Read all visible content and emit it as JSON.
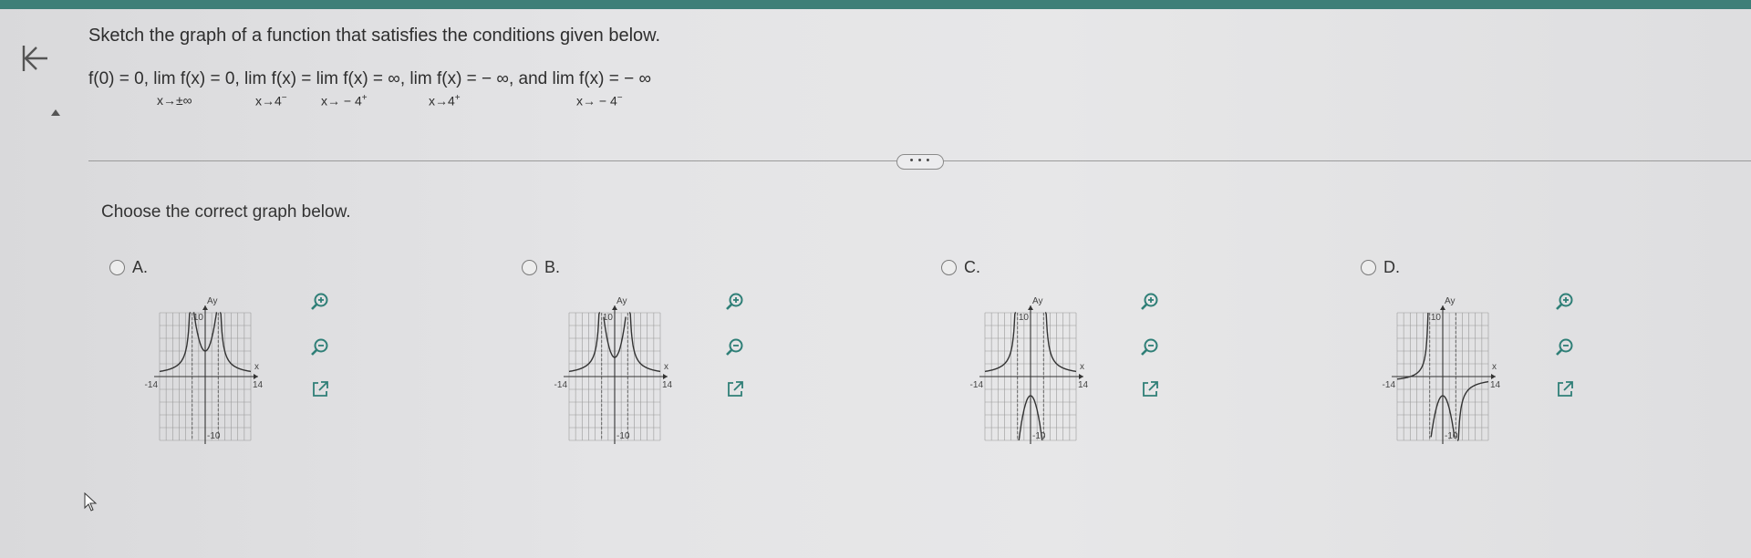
{
  "question": {
    "text": "Sketch the graph of a function that satisfies the conditions given below.",
    "formula": "f(0) = 0, lim f(x) = 0, lim f(x) = lim f(x) = ∞, lim f(x) = − ∞, and lim f(x) = − ∞",
    "subscripts": [
      "x→±∞",
      "x→4",
      "x→ − 4",
      "x→4",
      "x→ − 4"
    ],
    "subscript_signs": [
      "−",
      "+",
      "+",
      "−"
    ]
  },
  "more_label": "• • •",
  "prompt": "Choose the correct graph below.",
  "options": [
    {
      "letter": "A.",
      "y_label": "Ay",
      "x_label": "x",
      "y_max": "10",
      "y_min": "-10",
      "x_min": "-14",
      "x_max": "14"
    },
    {
      "letter": "B.",
      "y_label": "Ay",
      "x_label": "x",
      "y_max": "10",
      "y_min": "-10",
      "x_min": "-14",
      "x_max": "14"
    },
    {
      "letter": "C.",
      "y_label": "Ay",
      "x_label": "x",
      "y_max": "10",
      "y_min": "-10",
      "x_min": "-14",
      "x_max": "14"
    },
    {
      "letter": "D.",
      "y_label": "Ay",
      "x_label": "x",
      "y_max": "10",
      "y_min": "-10",
      "x_min": "-14",
      "x_max": "14"
    }
  ],
  "icons": {
    "back": "back-to-start-icon",
    "zoom_in": "zoom-in-icon",
    "zoom_out": "zoom-out-icon",
    "popout": "open-in-new-window-icon"
  },
  "colors": {
    "topbar": "#3e7f78",
    "tool_icon": "#2f7f77",
    "graph_curve": "#333333",
    "grid": "#9a9a9a"
  }
}
